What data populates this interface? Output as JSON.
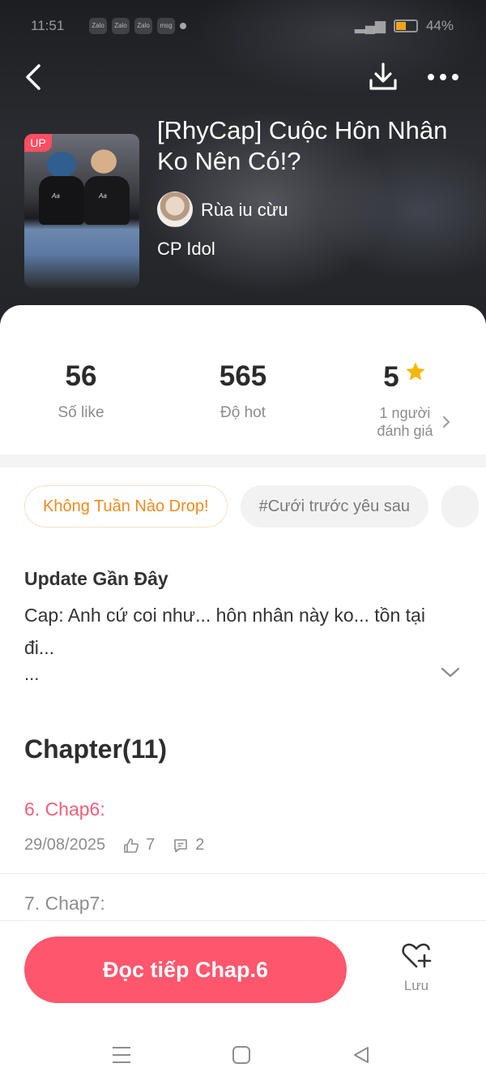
{
  "status_bar": {
    "time": "11:51",
    "apps": [
      "Zalo",
      "Zalo",
      "Zalo",
      "msg"
    ],
    "battery": "44%"
  },
  "story": {
    "badge": "UP",
    "title": "[RhyCap] Cuộc Hôn Nhân Ko Nên Có!?",
    "author": "Rùa iu cừu",
    "genre": "CP Idol"
  },
  "stats": {
    "likes": {
      "value": "56",
      "label": "Số like"
    },
    "hot": {
      "value": "565",
      "label": "Độ hot"
    },
    "rating": {
      "value": "5",
      "label_line1": "1 người",
      "label_line2": "đánh giá"
    }
  },
  "tags": [
    "Không Tuần Nào Drop!",
    "#Cưới trước yêu sau"
  ],
  "update": {
    "title": "Update Gần Đây",
    "text": "Cap: Anh cứ coi như... hôn nhân này ko... tồn tại đi...",
    "more": "..."
  },
  "chapters": {
    "heading": "Chapter(11)",
    "items": [
      {
        "title": "6. Chap6:",
        "date": "29/08/2025",
        "likes": "7",
        "comments": "2",
        "color": "#f0607a"
      },
      {
        "title": "7. Chap7:",
        "color": "#8e8e8e"
      }
    ]
  },
  "actions": {
    "read_label": "Đọc tiếp Chap.6",
    "save_label": "Lưu"
  },
  "colors": {
    "accent": "#fe566c",
    "tag_orange": "#ee8b1e",
    "star": "#f5b800"
  },
  "icons": [
    "back-icon",
    "download-icon",
    "more-icon",
    "star-icon",
    "chevron-right-icon",
    "chevron-down-icon",
    "thumbs-up-icon",
    "comment-icon",
    "heart-plus-icon",
    "menu-icon",
    "home-icon",
    "back-triangle-icon"
  ]
}
